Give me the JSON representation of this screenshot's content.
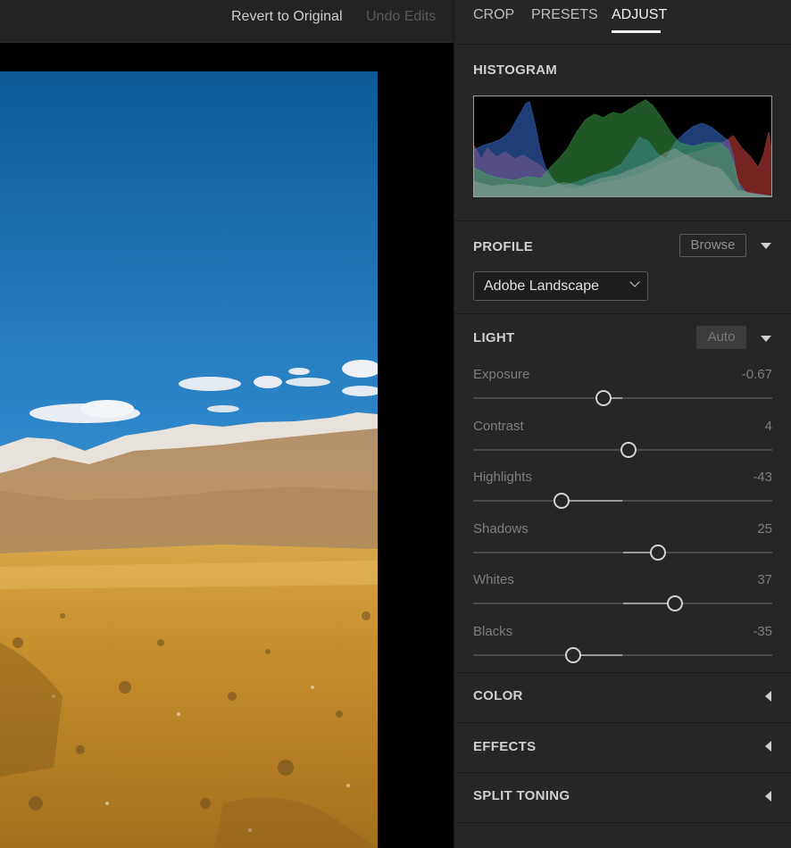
{
  "toolbar": {
    "revert_label": "Revert to Original",
    "undo_label": "Undo Edits"
  },
  "tabs": [
    {
      "label": "CROP",
      "active": false
    },
    {
      "label": "PRESETS",
      "active": false
    },
    {
      "label": "ADJUST",
      "active": true
    }
  ],
  "histogram": {
    "title": "HISTOGRAM"
  },
  "profile": {
    "title": "PROFILE",
    "browse_label": "Browse",
    "selected": "Adobe Landscape",
    "expand_icon": "triangle-down-icon"
  },
  "light": {
    "title": "LIGHT",
    "auto_label": "Auto",
    "sliders": [
      {
        "label": "Exposure",
        "value": "-0.67",
        "level": 0.436
      },
      {
        "label": "Contrast",
        "value": "4",
        "level": 0.52
      },
      {
        "label": "Highlights",
        "value": "-43",
        "level": 0.297
      },
      {
        "label": "Shadows",
        "value": "25",
        "level": 0.617
      },
      {
        "label": "Whites",
        "value": "37",
        "level": 0.675
      },
      {
        "label": "Blacks",
        "value": "-35",
        "level": 0.333
      }
    ]
  },
  "collapsed_sections": [
    {
      "title": "COLOR"
    },
    {
      "title": "EFFECTS"
    },
    {
      "title": "SPLIT TONING"
    }
  ],
  "colors": {
    "panel_bg": "#262626",
    "canvas_bg": "#000000",
    "histogram_red": "#d8423e",
    "histogram_green": "#3fae4f",
    "histogram_blue": "#3a6fd8"
  }
}
